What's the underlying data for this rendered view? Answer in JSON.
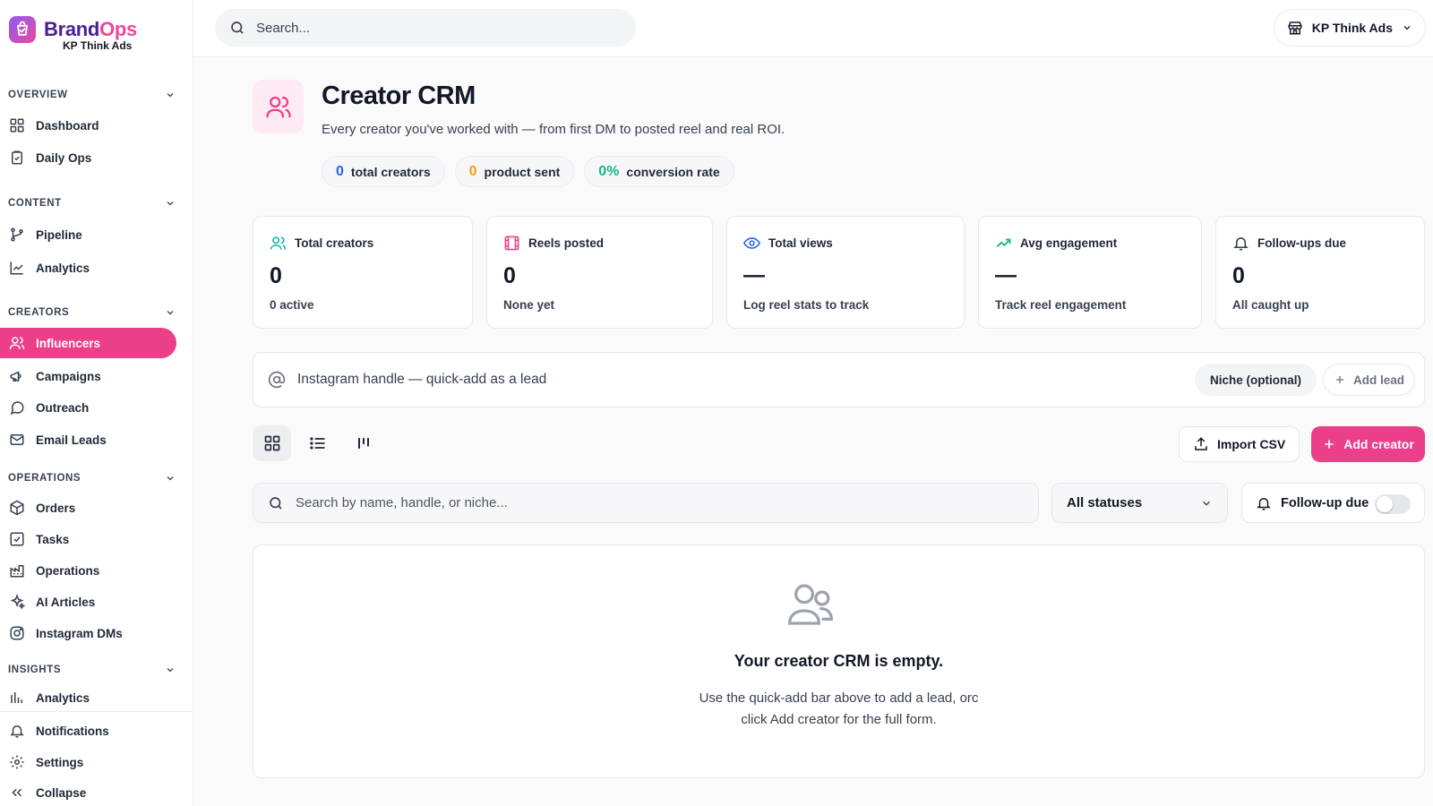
{
  "brand": {
    "name_part1": "Brand",
    "name_part2": "Ops",
    "workspace": "KP Think Ads"
  },
  "topbar": {
    "search_placeholder": "Search...",
    "workspace_label": "KP Think Ads"
  },
  "sidebar": {
    "sections": [
      {
        "label": "OVERVIEW",
        "items": [
          {
            "label": "Dashboard",
            "icon": "grid-icon"
          },
          {
            "label": "Daily Ops",
            "icon": "clipboard-check-icon"
          }
        ]
      },
      {
        "label": "CONTENT",
        "items": [
          {
            "label": "Pipeline",
            "icon": "branch-icon"
          },
          {
            "label": "Analytics",
            "icon": "line-chart-icon"
          }
        ]
      },
      {
        "label": "CREATORS",
        "items": [
          {
            "label": "Influencers",
            "icon": "users-icon",
            "active": true
          },
          {
            "label": "Campaigns",
            "icon": "megaphone-icon"
          },
          {
            "label": "Outreach",
            "icon": "message-icon"
          },
          {
            "label": "Email Leads",
            "icon": "mail-icon"
          }
        ]
      },
      {
        "label": "OPERATIONS",
        "items": [
          {
            "label": "Orders",
            "icon": "package-icon"
          },
          {
            "label": "Tasks",
            "icon": "checkbox-icon"
          },
          {
            "label": "Operations",
            "icon": "factory-icon"
          },
          {
            "label": "AI Articles",
            "icon": "sparkles-icon"
          },
          {
            "label": "Instagram DMs",
            "icon": "instagram-icon"
          }
        ]
      },
      {
        "label": "INSIGHTS",
        "items": [
          {
            "label": "Analytics",
            "icon": "bar-chart-icon"
          }
        ]
      }
    ],
    "footer": [
      {
        "label": "Notifications",
        "icon": "bell-icon"
      },
      {
        "label": "Settings",
        "icon": "gear-icon"
      },
      {
        "label": "Collapse",
        "icon": "chevrons-left-icon"
      }
    ]
  },
  "header": {
    "title": "Creator CRM",
    "subtitle": "Every creator you've worked with — from first DM to posted reel and real ROI.",
    "pills": [
      {
        "value": "0",
        "label": "total creators",
        "color": "#2563eb"
      },
      {
        "value": "0",
        "label": "product sent",
        "color": "#f59e0b"
      },
      {
        "value": "0%",
        "label": "conversion rate",
        "color": "#10b981"
      }
    ]
  },
  "stats": [
    {
      "label": "Total creators",
      "value": "0",
      "foot": "0 active",
      "icon": "users-icon",
      "color": "#14b8a6"
    },
    {
      "label": "Reels posted",
      "value": "0",
      "foot": "None yet",
      "icon": "film-icon",
      "color": "#ec3f8a"
    },
    {
      "label": "Total views",
      "value": "—",
      "foot": "Log reel stats to track",
      "icon": "eye-icon",
      "color": "#2563eb"
    },
    {
      "label": "Avg engagement",
      "value": "—",
      "foot": "Track reel engagement",
      "icon": "trending-up-icon",
      "color": "#10b981"
    },
    {
      "label": "Follow-ups due",
      "value": "0",
      "foot": "All caught up",
      "icon": "bell-icon",
      "color": "#374151"
    }
  ],
  "quick_add": {
    "placeholder": "Instagram handle — quick-add as a lead",
    "niche_placeholder": "Niche (optional)",
    "add_label": "Add lead"
  },
  "toolbar": {
    "import_label": "Import CSV",
    "add_label": "Add creator"
  },
  "filters": {
    "search_placeholder": "Search by name, handle, or niche...",
    "status_value": "All statuses",
    "followup_label": "Follow-up due",
    "followup_on": false
  },
  "empty": {
    "title": "Your creator CRM is empty.",
    "line1": "Use the quick-add bar above to add a lead, orc",
    "line2": "click Add creator for the full form."
  },
  "colors": {
    "accent": "#ec3f8a",
    "brand_purple": "#4c1d95"
  }
}
